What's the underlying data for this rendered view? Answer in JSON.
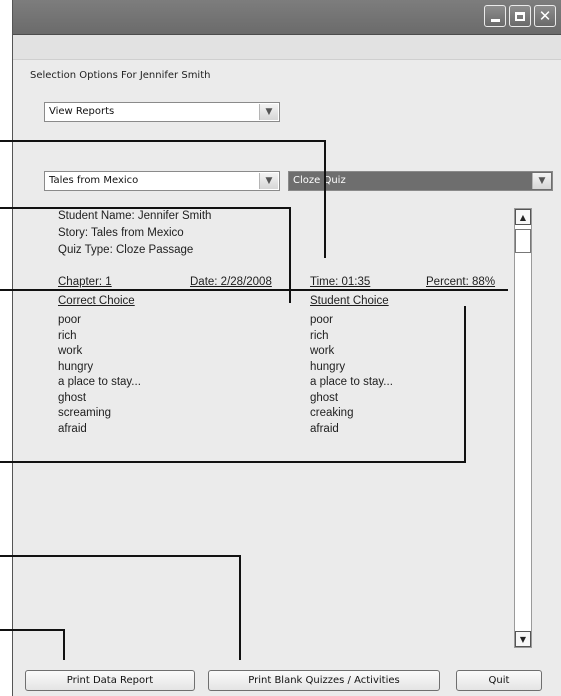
{
  "window": {
    "buttons": {
      "minimize": "minimize",
      "maximize": "maximize",
      "close": "✕"
    }
  },
  "selection": {
    "label": "Selection Options For Jennifer Smith",
    "view_select": "View Reports",
    "story_select": "Tales from Mexico",
    "quiz_select": "Cloze Quiz"
  },
  "report": {
    "student_name": "Student Name: Jennifer Smith",
    "story": "Story: Tales from Mexico",
    "quiz_type": "Quiz Type: Cloze Passage",
    "chapter": "Chapter: 1",
    "date": "Date: 2/28/2008",
    "time": "Time: 01:35",
    "percent": "Percent: 88%",
    "correct_header": "Correct Choice",
    "student_header": "Student Choice",
    "rows": [
      {
        "correct": "poor",
        "student": "poor"
      },
      {
        "correct": "rich",
        "student": "rich"
      },
      {
        "correct": "work",
        "student": "work"
      },
      {
        "correct": "hungry",
        "student": "hungry"
      },
      {
        "correct": "a place to stay...",
        "student": "a place to stay..."
      },
      {
        "correct": "ghost",
        "student": "ghost"
      },
      {
        "correct": "screaming",
        "student": "creaking"
      },
      {
        "correct": "afraid",
        "student": "afraid"
      }
    ]
  },
  "buttons": {
    "print_report": "Print Data Report",
    "print_blank": "Print Blank Quizzes / Activities",
    "quit": "Quit"
  },
  "icons": {
    "dropdown": "chevron-down-icon",
    "scroll_up": "arrow-up-icon",
    "scroll_down": "arrow-down-icon"
  }
}
